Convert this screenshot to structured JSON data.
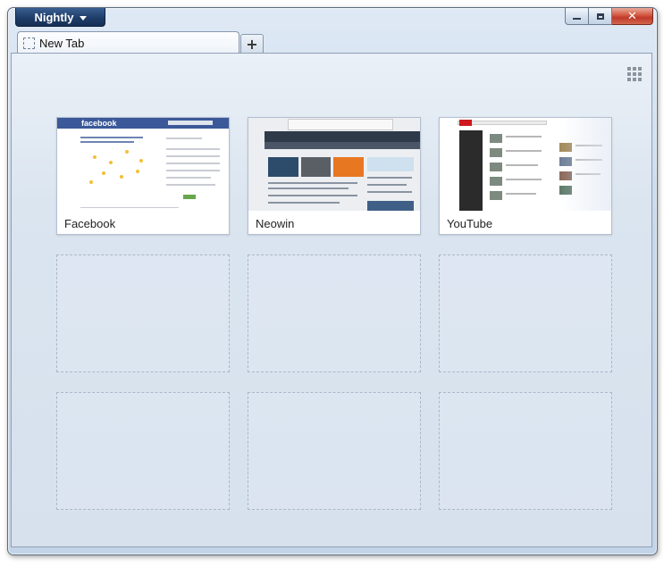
{
  "app": {
    "menu_button_label": "Nightly"
  },
  "tabs": [
    {
      "title": "New Tab"
    }
  ],
  "new_tab_button": {
    "icon": "plus-icon",
    "label": "+"
  },
  "caption_buttons": {
    "close_glyph": "✕"
  },
  "new_tab_page": {
    "grid_toggle_icon": "grid-icon",
    "tiles": [
      {
        "title": "Facebook",
        "thumbnail": "facebook"
      },
      {
        "title": "Neowin",
        "thumbnail": "neowin"
      },
      {
        "title": "YouTube",
        "thumbnail": "youtube"
      },
      {
        "title": "",
        "thumbnail": "empty"
      },
      {
        "title": "",
        "thumbnail": "empty"
      },
      {
        "title": "",
        "thumbnail": "empty"
      },
      {
        "title": "",
        "thumbnail": "empty"
      },
      {
        "title": "",
        "thumbnail": "empty"
      },
      {
        "title": "",
        "thumbnail": "empty"
      }
    ]
  },
  "colors": {
    "app_button": "#1f3d69",
    "close_button": "#c0392b",
    "content_bg": "#d7e1ed",
    "facebook_blue": "#3b5998",
    "youtube_red": "#cc181e"
  }
}
